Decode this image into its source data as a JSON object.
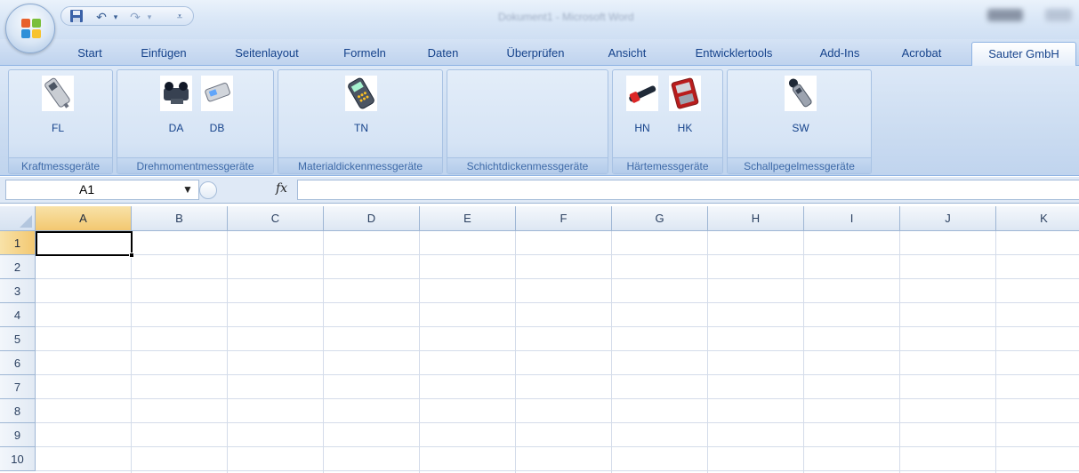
{
  "window": {
    "title": "Dokument1 - Microsoft Word"
  },
  "quick_access": {
    "save_icon": "save-icon",
    "undo_icon": "undo-icon",
    "redo_icon": "redo-icon",
    "customize_icon": "customize-qat-icon"
  },
  "tabs": [
    {
      "label": "Start"
    },
    {
      "label": "Einfügen"
    },
    {
      "label": "Seitenlayout"
    },
    {
      "label": "Formeln"
    },
    {
      "label": "Daten"
    },
    {
      "label": "Überprüfen"
    },
    {
      "label": "Ansicht"
    },
    {
      "label": "Entwicklertools"
    },
    {
      "label": "Add-Ins"
    },
    {
      "label": "Acrobat"
    },
    {
      "label": "Sauter GmbH",
      "active": true
    }
  ],
  "ribbon": {
    "groups": [
      {
        "label": "Kraftmessgeräte",
        "buttons": [
          {
            "label": "FL",
            "icon": "force-gauge-icon"
          }
        ]
      },
      {
        "label": "Drehmomentmessgeräte",
        "buttons": [
          {
            "label": "DA",
            "icon": "torque-tester-icon"
          },
          {
            "label": "DB",
            "icon": "torque-meter-icon"
          }
        ]
      },
      {
        "label": "Materialdickenmessgeräte",
        "buttons": [
          {
            "label": "TN",
            "icon": "thickness-gauge-icon"
          }
        ]
      },
      {
        "label": "Schichtdickenmessgeräte",
        "buttons": []
      },
      {
        "label": "Härtemessgeräte",
        "buttons": [
          {
            "label": "HN",
            "icon": "hardness-pen-icon"
          },
          {
            "label": "HK",
            "icon": "hardness-tester-icon"
          }
        ]
      },
      {
        "label": "Schallpegelmessgeräte",
        "buttons": [
          {
            "label": "SW",
            "icon": "sound-level-meter-icon"
          }
        ]
      }
    ]
  },
  "formula_bar": {
    "name_box": "A1",
    "fx": "fx",
    "value": ""
  },
  "sheet": {
    "columns": [
      "A",
      "B",
      "C",
      "D",
      "E",
      "F",
      "G",
      "H",
      "I",
      "J",
      "K"
    ],
    "rows": [
      "1",
      "2",
      "3",
      "4",
      "5",
      "6",
      "7",
      "8",
      "9",
      "10"
    ],
    "active_cell": "A1"
  }
}
